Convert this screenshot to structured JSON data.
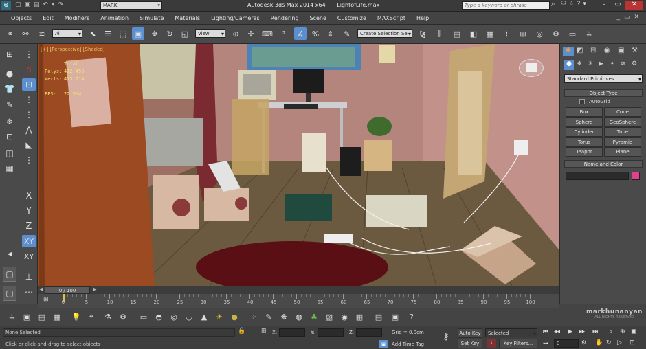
{
  "window": {
    "title": "Autodesk 3ds Max  2014 x64",
    "file": "LightofLife.max",
    "search_placeholder": "Type a keyword or phrase",
    "workspace": "MARK"
  },
  "menu": [
    "Objects",
    "Edit",
    "Modifiers",
    "Animation",
    "Simulate",
    "Materials",
    "Lighting/Cameras",
    "Rendering",
    "Scene",
    "Customize",
    "MAXScript",
    "Help"
  ],
  "toolbar": {
    "filter": "All",
    "ref_coord": "View",
    "selection_set": "Create Selection Se"
  },
  "viewport": {
    "label": "[+] [Perspective] [Shaded]",
    "stats": {
      "total_label": "Total",
      "polys_label": "Polys:",
      "polys": "412,450",
      "verts_label": "Verts:",
      "verts": "473,714",
      "fps_label": "FPS:",
      "fps": "22.564"
    }
  },
  "axis_buttons": [
    "X",
    "Y",
    "Z",
    "XY",
    "XY"
  ],
  "command_panel": {
    "dropdown": "Standard Primitives",
    "object_type": "Object Type",
    "autogrid": "AutoGrid",
    "buttons": [
      [
        "Box",
        "Cone"
      ],
      [
        "Sphere",
        "GeoSphere"
      ],
      [
        "Cylinder",
        "Tube"
      ],
      [
        "Torus",
        "Pyramid"
      ],
      [
        "Teapot",
        "Plane"
      ]
    ],
    "name_color": "Name and Color",
    "color": "#e0418f"
  },
  "timeline": {
    "slider": "0 / 100",
    "ticks": [
      "0",
      "5",
      "10",
      "15",
      "20",
      "25",
      "30",
      "35",
      "40",
      "45",
      "50",
      "55",
      "60",
      "65",
      "70",
      "75",
      "80",
      "85",
      "90",
      "95",
      "100"
    ]
  },
  "status": {
    "selection": "None Selected",
    "prompt": "Click or click-and-drag to select objects",
    "x_label": "X:",
    "y_label": "Y:",
    "z_label": "Z:",
    "grid": "Grid = 0.0cm",
    "add_time_tag": "Add Time Tag",
    "auto_key": "Auto Key",
    "set_key": "Set Key",
    "key_mode": "Selected",
    "key_filters": "Key Filters...",
    "frame": "0"
  },
  "watermark": {
    "name": "markhunanyan",
    "sub": "ALL RIGHTS RESERVED"
  }
}
